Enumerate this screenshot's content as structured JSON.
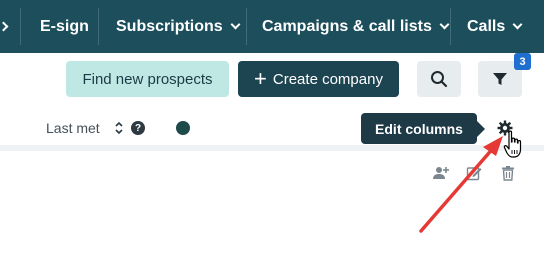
{
  "nav": {
    "items": [
      {
        "label": "E-sign"
      },
      {
        "label": "Subscriptions"
      },
      {
        "label": "Campaigns & call lists"
      },
      {
        "label": "Calls"
      }
    ]
  },
  "toolbar": {
    "find_prospects_label": "Find new prospects",
    "create_company_label": "Create company",
    "filter_count": "3"
  },
  "table": {
    "column_label": "Last met",
    "tooltip": "Edit columns"
  },
  "icons": {
    "search": "search-icon",
    "filter": "filter-icon",
    "settings": "gear-icon",
    "help": "help-icon",
    "sort": "sort-icon",
    "add_contact": "add-contact-icon",
    "edit": "edit-icon",
    "delete": "trash-icon"
  },
  "colors": {
    "nav_bg": "#1d4e5c",
    "primary": "#1d4451",
    "prospects_bg": "#bfe8e4",
    "badge": "#1f6fd1",
    "annotation_arrow": "#e53935"
  }
}
